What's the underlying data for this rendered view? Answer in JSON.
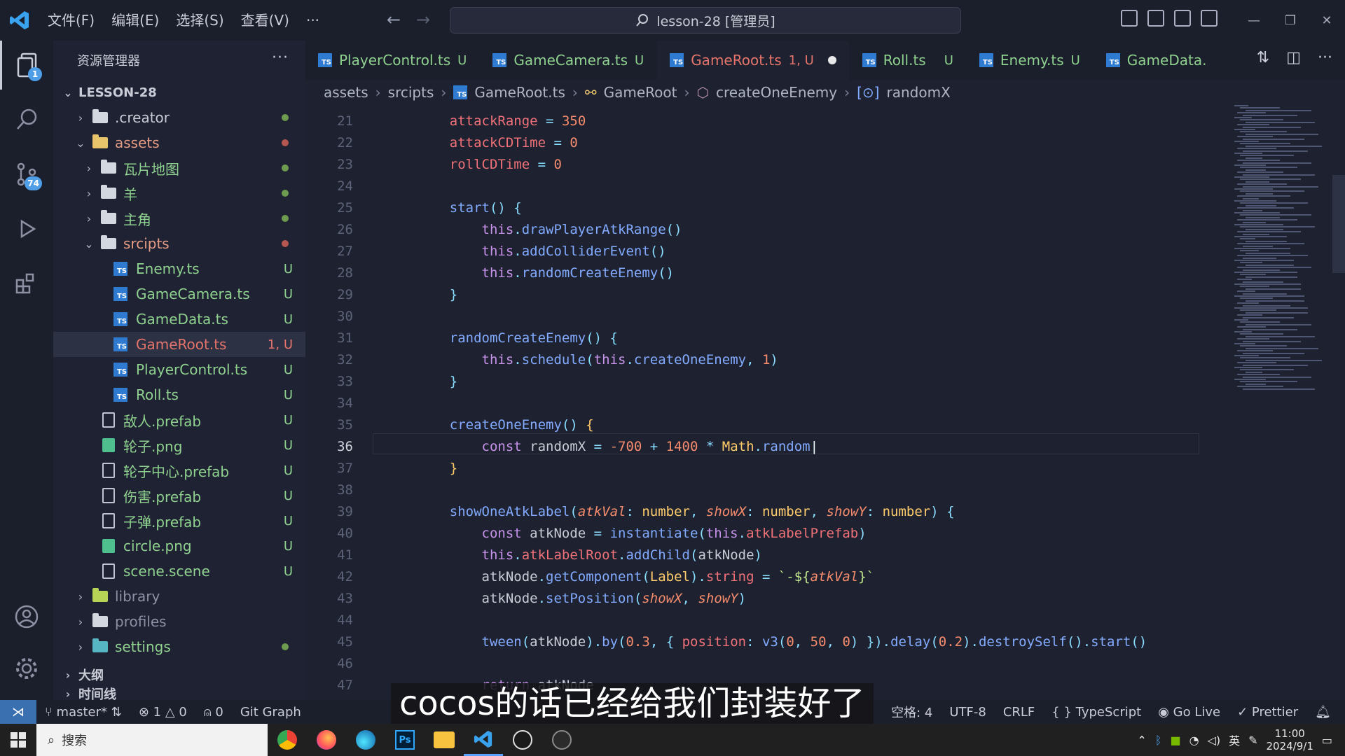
{
  "titlebar": {
    "menus": [
      "文件(F)",
      "编辑(E)",
      "选择(S)",
      "查看(V)",
      "···"
    ],
    "search_text": "lesson-28 [管理员]"
  },
  "activity": {
    "explorer_badge": "1",
    "scm_badge": "74"
  },
  "sidebar": {
    "title": "资源管理器",
    "more": "···",
    "root": "LESSON-28",
    "items": [
      {
        "label": ".creator",
        "status": ""
      },
      {
        "label": "assets",
        "status": ""
      },
      {
        "label": "瓦片地图",
        "status": ""
      },
      {
        "label": "羊",
        "status": ""
      },
      {
        "label": "主角",
        "status": ""
      },
      {
        "label": "srcipts",
        "status": ""
      },
      {
        "label": "Enemy.ts",
        "status": "U"
      },
      {
        "label": "GameCamera.ts",
        "status": "U"
      },
      {
        "label": "GameData.ts",
        "status": "U"
      },
      {
        "label": "GameRoot.ts",
        "status": "1, U"
      },
      {
        "label": "PlayerControl.ts",
        "status": "U"
      },
      {
        "label": "Roll.ts",
        "status": "U"
      },
      {
        "label": "敌人.prefab",
        "status": "U"
      },
      {
        "label": "轮子.png",
        "status": "U"
      },
      {
        "label": "轮子中心.prefab",
        "status": "U"
      },
      {
        "label": "伤害.prefab",
        "status": "U"
      },
      {
        "label": "子弹.prefab",
        "status": "U"
      },
      {
        "label": "circle.png",
        "status": "U"
      },
      {
        "label": "scene.scene",
        "status": "U"
      },
      {
        "label": "library",
        "status": ""
      },
      {
        "label": "profiles",
        "status": ""
      },
      {
        "label": "settings",
        "status": ""
      }
    ],
    "outline": "大纲",
    "timeline": "时间线"
  },
  "tabs": [
    {
      "label": "PlayerControl.ts",
      "mark": "U"
    },
    {
      "label": "GameCamera.ts",
      "mark": "U"
    },
    {
      "label": "GameRoot.ts",
      "mark": "1, U"
    },
    {
      "label": "Roll.ts",
      "mark": "U"
    },
    {
      "label": "Enemy.ts",
      "mark": "U"
    },
    {
      "label": "GameData.",
      "mark": ""
    }
  ],
  "breadcrumb": [
    "assets",
    "srcipts",
    "GameRoot.ts",
    "GameRoot",
    "createOneEnemy",
    "randomX"
  ],
  "editor": {
    "line_numbers": [
      "21",
      "22",
      "23",
      "24",
      "25",
      "26",
      "27",
      "28",
      "29",
      "30",
      "31",
      "32",
      "33",
      "34",
      "35",
      "36",
      "37",
      "38",
      "39",
      "40",
      "41",
      "42",
      "43",
      "44",
      "45",
      "46",
      "47"
    ],
    "current_line": "36"
  },
  "statusbar": {
    "branch": "master*",
    "errors": "1",
    "warnings": "0",
    "ports": "0",
    "git_graph": "Git Graph",
    "spaces": "空格: 4",
    "encoding": "UTF-8",
    "eol": "CRLF",
    "language": "TypeScript",
    "golive": "Go Live",
    "prettier": "Prettier"
  },
  "subtitle": "cocos的话已经给我们封装好了",
  "taskbar": {
    "search": "搜索",
    "time": "11:00",
    "date": "2024/9/1"
  },
  "colors": {
    "accent": "#3a6fb0",
    "modified": "#e5746b",
    "untracked": "#8fd18e"
  }
}
